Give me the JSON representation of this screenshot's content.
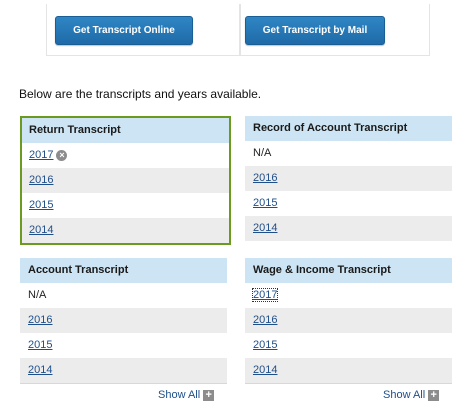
{
  "buttons": {
    "online": "Get Transcript Online",
    "mail": "Get Transcript by Mail"
  },
  "intro": "Below are the transcripts and years available.",
  "panels": {
    "return": {
      "title": "Return Transcript",
      "rows": [
        "2017",
        "2016",
        "2015",
        "2014"
      ]
    },
    "record": {
      "title": "Record of Account Transcript",
      "rows": [
        "N/A",
        "2016",
        "2015",
        "2014"
      ]
    },
    "account": {
      "title": "Account Transcript",
      "rows": [
        "N/A",
        "2016",
        "2015",
        "2014"
      ]
    },
    "wage": {
      "title": "Wage & Income Transcript",
      "rows": [
        "2017",
        "2016",
        "2015",
        "2014"
      ]
    }
  },
  "show_all": "Show All",
  "icons": {
    "clear": "close-circle-icon",
    "expand": "plus-icon"
  },
  "colors": {
    "button": "#1f6aa8",
    "header": "#cce4f3",
    "selected_border": "#6a9a1f",
    "link": "#1f4f8a"
  }
}
